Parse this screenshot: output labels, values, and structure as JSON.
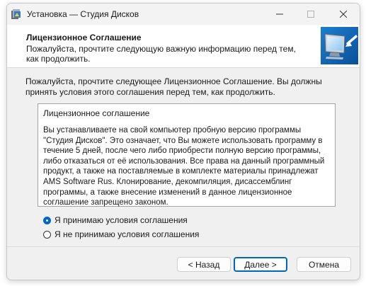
{
  "window": {
    "title": "Установка — Студия Дисков"
  },
  "header": {
    "title": "Лицензионное Соглашение",
    "subtitle": "Пожалуйста, прочтите следующую важную информацию перед тем, как продолжить."
  },
  "intro": "Пожалуйста, прочтите следующее Лицензионное Соглашение. Вы должны принять условия этого соглашения перед тем, как продолжить.",
  "license": {
    "title": "Лицензионное соглашение",
    "body": "Вы устанавливаете на свой компьютер пробную версию программы \"Студия Дисков\". Это означает, что Вы можете использовать программу в течение 5 дней, после чего либо приобрести полную версию программы, либо отказаться от её использования. Все права на данный программный продукт, а также на поставляемые в комплекте материалы принадлежат AMS Software Rus. Клонирование, декомпиляция, дисассемблинг программы, а также внесение изменений в данное лицензионное соглашение запрещено законом."
  },
  "options": {
    "accept": "Я принимаю условия соглашения",
    "decline": "Я не принимаю условия соглашения",
    "selected": "accept"
  },
  "buttons": {
    "back": "< Назад",
    "next": "Далее >",
    "cancel": "Отмена"
  },
  "colors": {
    "accent": "#0067c0",
    "dialog_bg": "#f0f0f0"
  }
}
